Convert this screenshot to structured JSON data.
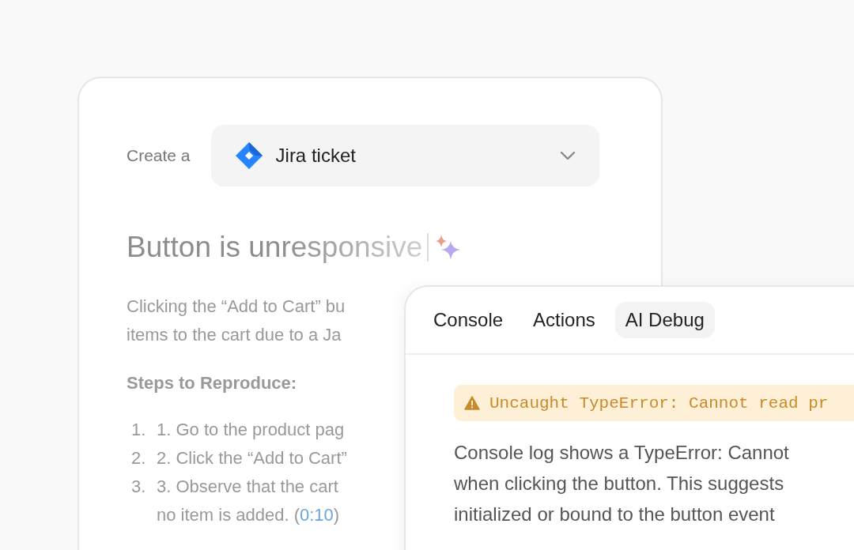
{
  "ticket_card": {
    "create_label": "Create a",
    "ticket_type": {
      "label": "Jira ticket"
    },
    "title": "Button is unresponsive",
    "description_lines": [
      "Clicking the “Add to Cart” bu",
      "items to the cart due to a Ja"
    ],
    "steps_heading": "Steps to Reproduce:",
    "steps": [
      {
        "number": "1.",
        "lines": [
          "1. Go to the product pag"
        ]
      },
      {
        "number": "2.",
        "lines": [
          "2. Click the “Add to Cart”"
        ]
      },
      {
        "number": "3.",
        "lines": [
          "3. Observe that the cart"
        ],
        "continuation": "no item is added. (",
        "timestamp": "0:10",
        "trail": ")"
      }
    ]
  },
  "debug_panel": {
    "tabs": [
      {
        "label": "Console",
        "selected": false
      },
      {
        "label": "Actions",
        "selected": false
      },
      {
        "label": "AI Debug",
        "selected": true
      }
    ],
    "error_banner": "Uncaught TypeError: Cannot read pr",
    "explanation_lines": [
      "Console log shows a TypeError: Cannot",
      "when clicking the button. This suggests",
      "initialized or bound to the button event"
    ]
  }
}
